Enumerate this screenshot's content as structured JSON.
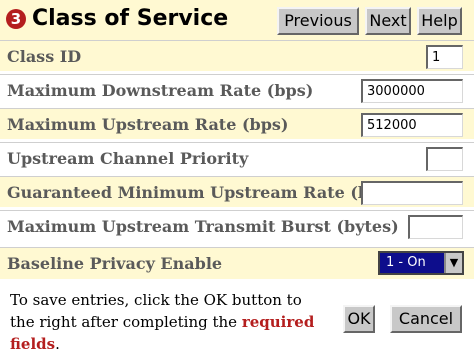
{
  "header": {
    "step_number": "3",
    "title": "Class of Service",
    "previous_label": "Previous",
    "next_label": "Next",
    "help_label": "Help"
  },
  "form": {
    "class_id": {
      "label": "Class ID",
      "value": "1"
    },
    "max_downstream": {
      "label": "Maximum Downstream Rate (bps)",
      "value": "3000000"
    },
    "max_upstream": {
      "label": "Maximum Upstream Rate (bps)",
      "value": "512000"
    },
    "upstream_priority": {
      "label": "Upstream Channel Priority",
      "value": ""
    },
    "guaranteed_min_upstream": {
      "label": "Guaranteed Minimum Upstream Rate (bps)",
      "value": ""
    },
    "max_upstream_burst": {
      "label": "Maximum Upstream Transmit Burst (bytes)",
      "value": ""
    },
    "baseline_privacy": {
      "label": "Baseline Privacy Enable",
      "selected": "1 - On"
    }
  },
  "footer": {
    "instruction_prefix": "To save entries, click the OK button to the right after completing the ",
    "required_text": "required fields",
    "instruction_suffix": ".",
    "ok_label": "OK",
    "cancel_label": "Cancel"
  },
  "colors": {
    "header_bg": "#fff9d2",
    "accent_red": "#b41e1e",
    "select_bg": "#0d0d8c"
  }
}
